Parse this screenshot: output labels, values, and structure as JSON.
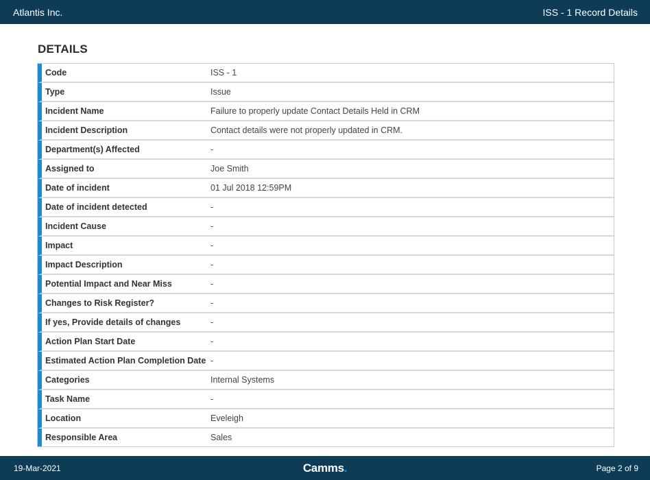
{
  "header": {
    "company": "Atlantis Inc.",
    "record_title": "ISS - 1 Record Details"
  },
  "section_title": "DETAILS",
  "rows": [
    {
      "label": "Code",
      "value": "ISS - 1"
    },
    {
      "label": "Type",
      "value": "Issue"
    },
    {
      "label": "Incident Name",
      "value": "Failure to properly update Contact Details Held in CRM"
    },
    {
      "label": "Incident Description",
      "value": "Contact details were not properly updated in CRM."
    },
    {
      "label": "Department(s) Affected",
      "value": "-"
    },
    {
      "label": "Assigned to",
      "value": "Joe Smith"
    },
    {
      "label": "Date of incident",
      "value": "01 Jul 2018 12:59PM"
    },
    {
      "label": "Date of incident detected",
      "value": "-"
    },
    {
      "label": "Incident Cause",
      "value": "-"
    },
    {
      "label": "Impact",
      "value": "-"
    },
    {
      "label": "Impact Description",
      "value": "-"
    },
    {
      "label": "Potential Impact and Near Miss",
      "value": "-"
    },
    {
      "label": "Changes to Risk Register?",
      "value": "-"
    },
    {
      "label": "If yes, Provide details of changes",
      "value": "-"
    },
    {
      "label": "Action Plan Start Date",
      "value": "-"
    },
    {
      "label": "Estimated Action Plan Completion Date",
      "value": "-"
    },
    {
      "label": "Categories",
      "value": "Internal Systems"
    },
    {
      "label": "Task Name",
      "value": "-"
    },
    {
      "label": "Location",
      "value": "Eveleigh"
    },
    {
      "label": "Responsible Area",
      "value": "Sales"
    }
  ],
  "footer": {
    "date": "19-Mar-2021",
    "brand": "Camms",
    "brand_dot": ".",
    "page": "Page 2 of 9"
  },
  "colors": {
    "header_bg": "#0e3c57",
    "accent_bar": "#1b8bd6",
    "row_border": "#d7d7d7"
  }
}
